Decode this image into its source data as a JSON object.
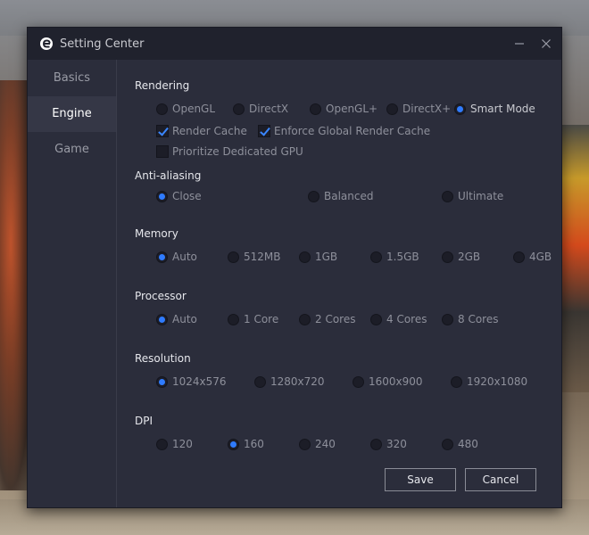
{
  "window": {
    "title": "Setting Center"
  },
  "sidebar": {
    "items": [
      {
        "label": "Basics"
      },
      {
        "label": "Engine"
      },
      {
        "label": "Game"
      }
    ]
  },
  "rendering": {
    "title": "Rendering",
    "options": [
      "OpenGL",
      "DirectX",
      "OpenGL+",
      "DirectX+",
      "Smart Mode"
    ],
    "selected": "Smart Mode",
    "render_cache": "Render Cache",
    "enforce_cache": "Enforce Global Render Cache",
    "prioritize_gpu": "Prioritize Dedicated GPU"
  },
  "antialiasing": {
    "title": "Anti-aliasing",
    "options": [
      "Close",
      "Balanced",
      "Ultimate"
    ],
    "selected": "Close"
  },
  "memory": {
    "title": "Memory",
    "options": [
      "Auto",
      "512MB",
      "1GB",
      "1.5GB",
      "2GB",
      "4GB"
    ],
    "selected": "Auto"
  },
  "processor": {
    "title": "Processor",
    "options": [
      "Auto",
      "1 Core",
      "2 Cores",
      "4 Cores",
      "8 Cores"
    ],
    "selected": "Auto"
  },
  "resolution": {
    "title": "Resolution",
    "options": [
      "1024x576",
      "1280x720",
      "1600x900",
      "1920x1080"
    ],
    "selected": "1024x576"
  },
  "dpi": {
    "title": "DPI",
    "options": [
      "120",
      "160",
      "240",
      "320",
      "480"
    ],
    "selected": "160"
  },
  "buttons": {
    "save": "Save",
    "cancel": "Cancel"
  },
  "colors": {
    "accent": "#2f7bff",
    "window_bg": "#2b2d3b",
    "titlebar_bg": "#20222d"
  }
}
